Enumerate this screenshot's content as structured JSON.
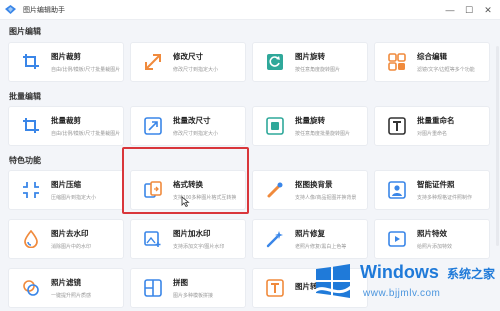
{
  "window": {
    "title": "图片编辑助手"
  },
  "sections": {
    "edit": {
      "title": "图片编辑",
      "tools": [
        {
          "title": "图片裁剪",
          "desc": "自由/比例/模板/尺寸批量裁图片",
          "icon": "crop-icon"
        },
        {
          "title": "修改尺寸",
          "desc": "修改尺寸到指定大小",
          "icon": "resize-icon"
        },
        {
          "title": "图片旋转",
          "desc": "按任意角度旋转图片",
          "icon": "rotate-icon"
        },
        {
          "title": "综合编辑",
          "desc": "滤镜/文字/边框等多个功能",
          "icon": "grid-icon"
        }
      ]
    },
    "batch": {
      "title": "批量编辑",
      "tools": [
        {
          "title": "批量裁剪",
          "desc": "自由/比例/模板/尺寸批量裁图片",
          "icon": "crop-icon"
        },
        {
          "title": "批量改尺寸",
          "desc": "修改尺寸到指定大小",
          "icon": "resize-icon"
        },
        {
          "title": "批量旋转",
          "desc": "按任意角度批量旋转图片",
          "icon": "rotate-icon"
        },
        {
          "title": "批量重命名",
          "desc": "对图片重命名",
          "icon": "text-icon"
        }
      ]
    },
    "special": {
      "title": "特色功能",
      "tools": [
        {
          "title": "图片压缩",
          "desc": "压缩图片到指定大小",
          "icon": "compress-icon"
        },
        {
          "title": "格式转换",
          "desc": "支持100多种图片格式互转换",
          "icon": "convert-icon"
        },
        {
          "title": "抠图换背景",
          "desc": "支持人像/商品抠图并换背景",
          "icon": "wand-icon"
        },
        {
          "title": "智能证件照",
          "desc": "支持多种规格证件照制作",
          "icon": "id-photo-icon"
        },
        {
          "title": "图片去水印",
          "desc": "消除图片中的水印",
          "icon": "drop-icon"
        },
        {
          "title": "图片加水印",
          "desc": "支持添加文字/图片水印",
          "icon": "image-plus-icon"
        },
        {
          "title": "照片修复",
          "desc": "老照片修复/黑白上色等",
          "icon": "magic-icon"
        },
        {
          "title": "照片特效",
          "desc": "给照片添加特效",
          "icon": "film-icon"
        },
        {
          "title": "照片滤镜",
          "desc": "一键提升照片质感",
          "icon": "filter-icon"
        },
        {
          "title": "拼图",
          "desc": "图片多种模板拼接",
          "icon": "puzzle-icon"
        },
        {
          "title": "图片转",
          "desc": "",
          "icon": "doc-t-icon"
        }
      ]
    }
  },
  "watermark": {
    "brand": "Windows",
    "cn": "系统之家",
    "url": "www.bjjmlv.com"
  },
  "colors": {
    "accent": "#1f7ad9",
    "highlight": "#d9363b",
    "icon_blue": "#3a86e8",
    "icon_orange": "#f08a3c",
    "icon_teal": "#2fa89a"
  }
}
